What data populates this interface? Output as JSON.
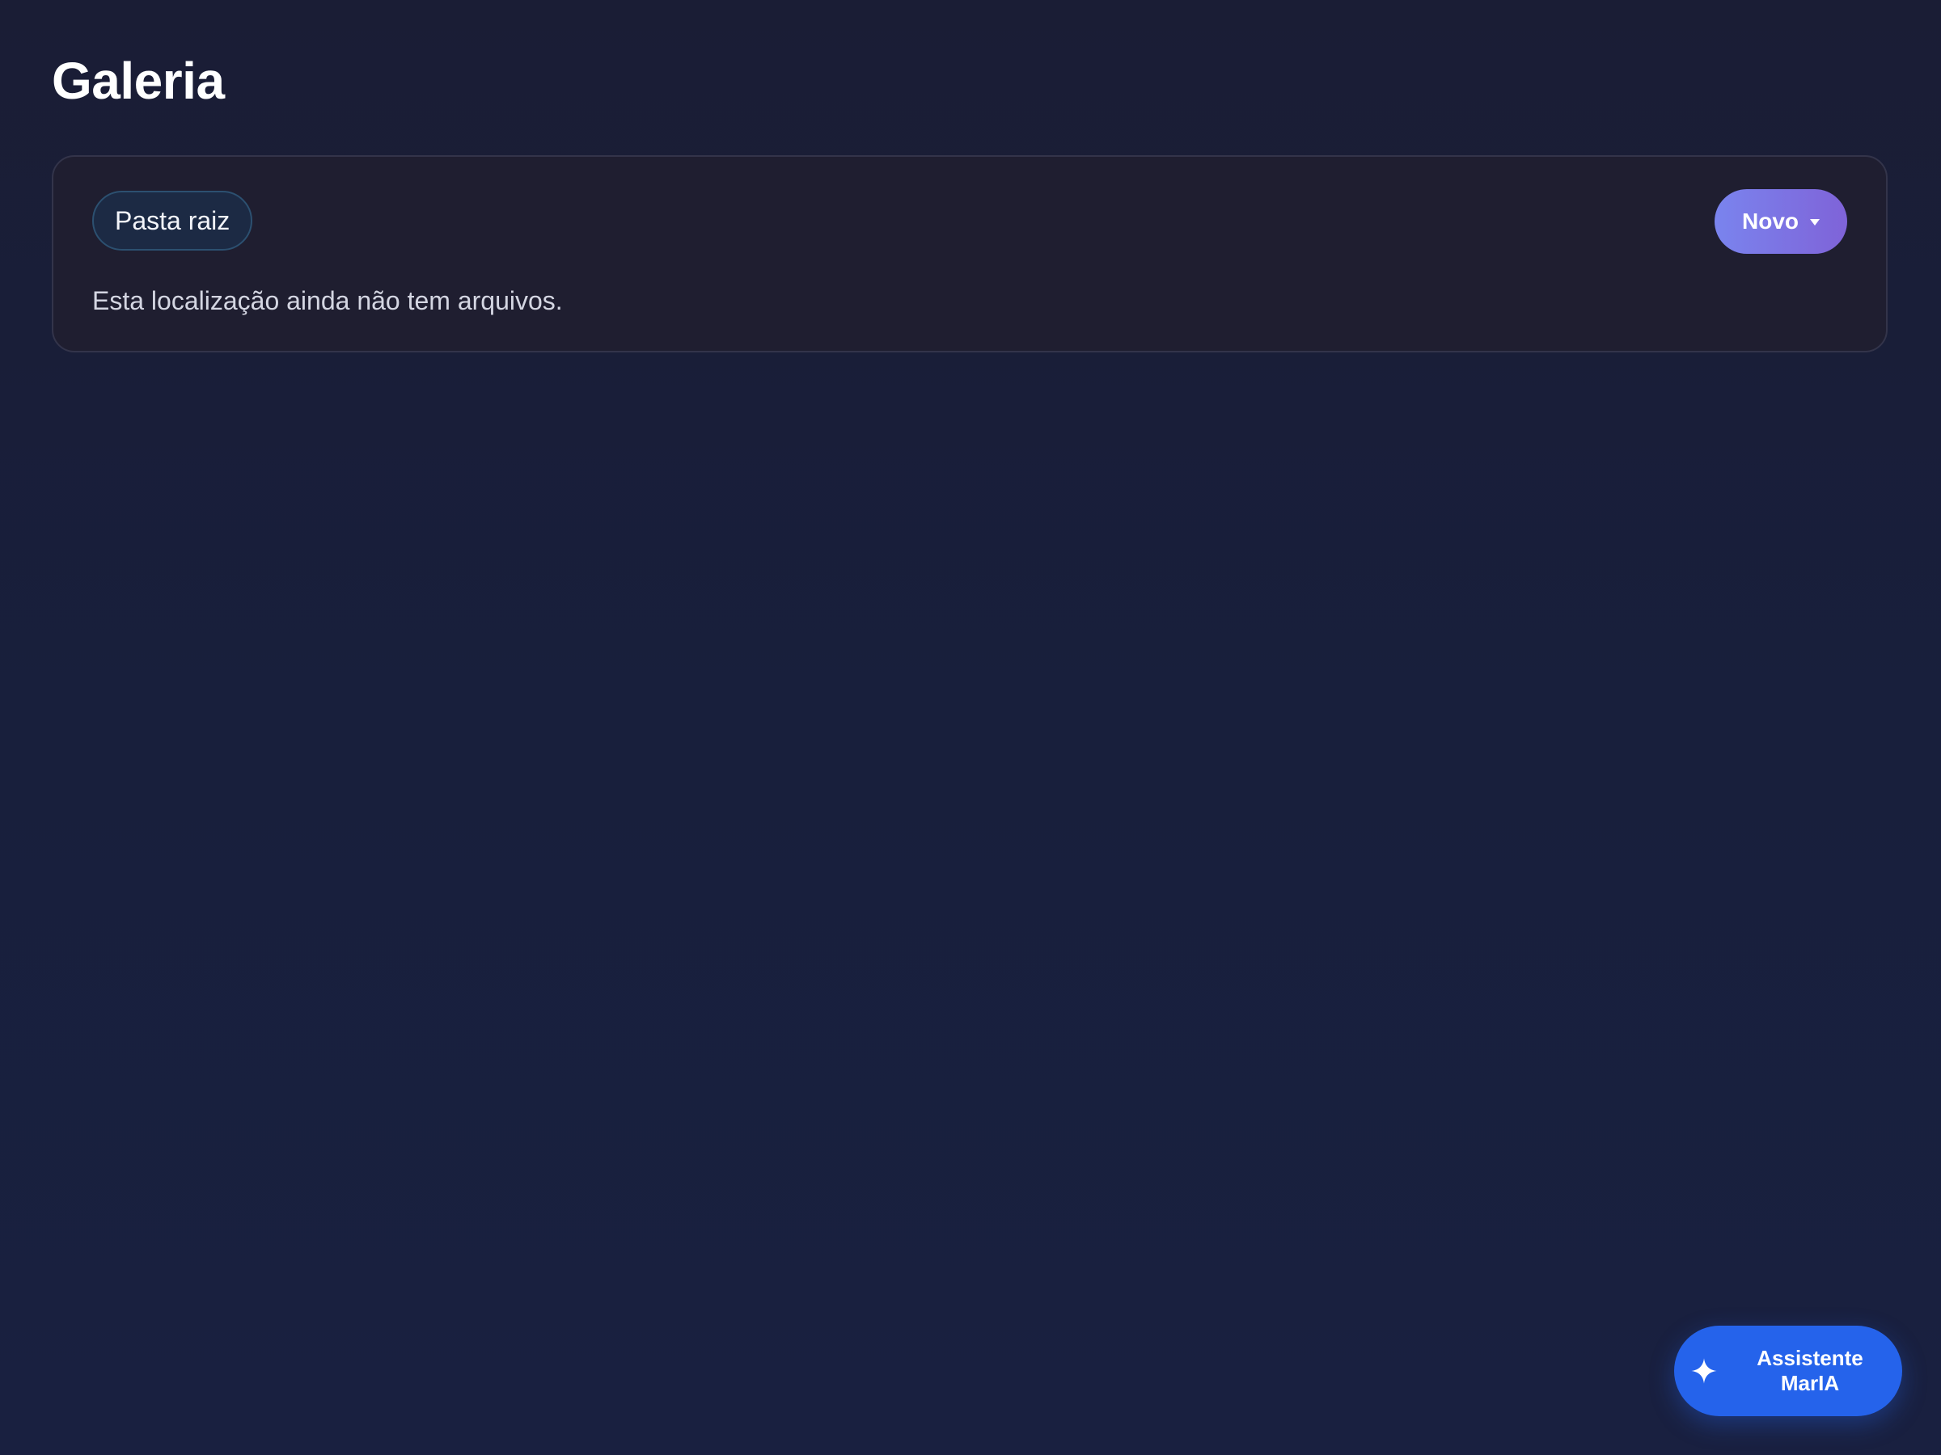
{
  "header": {
    "title": "Galeria"
  },
  "panel": {
    "breadcrumb": "Pasta raiz",
    "new_button_label": "Novo",
    "new_button_icon": "chevron-down-icon",
    "empty_message": "Esta localização ainda não tem arquivos."
  },
  "assistant": {
    "label": "Assistente MarIA",
    "icon": "sparkle-icon"
  },
  "colors": {
    "background": "#1a1d35",
    "panel": "#1f1e30",
    "accent_gradient_start": "#7a84ee",
    "accent_gradient_end": "#7f63d8",
    "assistant_button": "#2563eb"
  }
}
